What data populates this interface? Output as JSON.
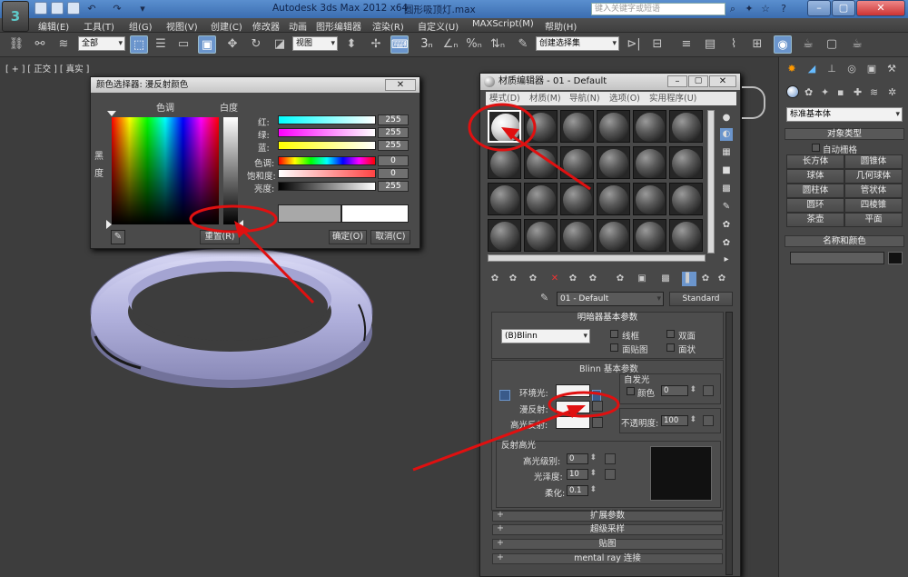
{
  "titlebar": {
    "app_title": "Autodesk 3ds Max  2012 x64",
    "file_name": "圆形吸顶灯.max",
    "search_placeholder": "键入关键字或短语",
    "logo": "3"
  },
  "menubar": {
    "items": [
      "编辑(E)",
      "工具(T)",
      "组(G)",
      "视图(V)",
      "创建(C)",
      "修改器",
      "动画",
      "图形编辑器",
      "渲染(R)",
      "自定义(U)",
      "MAXScript(M)",
      "帮助(H)"
    ]
  },
  "toolbar": {
    "selection_filter": "全部",
    "ref_coord": "视图",
    "named_selection": "创建选择集"
  },
  "viewport": {
    "label": "[ + ] [ 正交 ] [ 真实 ]",
    "colors": {
      "torus": "#b8b8e0",
      "background": "#3d3d3d"
    }
  },
  "color_picker": {
    "title": "颜色选择器: 漫反射颜色",
    "hue_label": "色调",
    "white_label": "白度",
    "black_label_1": "黑",
    "black_label_2": "度",
    "rows": [
      {
        "label": "红:",
        "value": "255"
      },
      {
        "label": "绿:",
        "value": "255"
      },
      {
        "label": "蓝:",
        "value": "255"
      },
      {
        "label": "色调:",
        "value": "0"
      },
      {
        "label": "饱和度:",
        "value": "0"
      },
      {
        "label": "亮度:",
        "value": "255"
      }
    ],
    "reset_button": "重置(R)",
    "ok_button": "确定(O)",
    "cancel_button": "取消(C)"
  },
  "material_editor": {
    "title": "材质编辑器 - 01 - Default",
    "menu": [
      "模式(D)",
      "材质(M)",
      "导航(N)",
      "选项(O)",
      "实用程序(U)"
    ],
    "material_name": "01 - Default",
    "material_type": "Standard",
    "shader_rollout": {
      "title": "明暗器基本参数",
      "shader": "(B)Blinn",
      "wire": "线框",
      "two_sided": "双面",
      "face_map": "面贴图",
      "faceted": "面状"
    },
    "blinn_rollout": {
      "title": "Blinn 基本参数",
      "self_illum_title": "自发光",
      "color_label": "颜色",
      "self_illum_value": "0",
      "ambient": "环境光:",
      "diffuse": "漫反射:",
      "specular": "高光反射:",
      "opacity_label": "不透明度:",
      "opacity_value": "100",
      "spec_title": "反射高光",
      "spec_level_label": "高光级别:",
      "spec_level": "0",
      "gloss_label": "光泽度:",
      "gloss": "10",
      "soften_label": "柔化:",
      "soften": "0.1"
    },
    "collapsed_rollouts": [
      "扩展参数",
      "超级采样",
      "贴图",
      "mental ray 连接"
    ]
  },
  "command_panel": {
    "dropdown": "标准基本体",
    "object_type_title": "对象类型",
    "autogrid": "自动栅格",
    "buttons": [
      "长方体",
      "圆锥体",
      "球体",
      "几何球体",
      "圆柱体",
      "管状体",
      "圆环",
      "四棱锥",
      "茶壶",
      "平面"
    ],
    "name_color_title": "名称和颜色"
  },
  "annotation_color": "#e01010"
}
